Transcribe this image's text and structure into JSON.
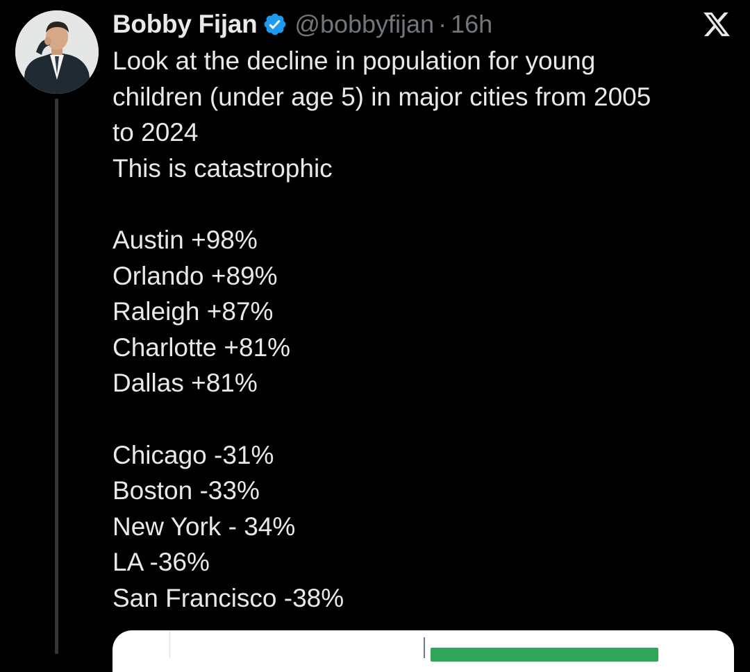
{
  "tweet": {
    "author": {
      "display_name": "Bobby Fijan",
      "handle": "@bobbyfijan",
      "separator": "·",
      "time": "16h",
      "verified": true
    },
    "lines": [
      "Look at the decline in population for young",
      "children (under age 5) in major cities from 2005",
      "to 2024",
      "This is catastrophic"
    ],
    "growth_list": [
      "Austin +98%",
      "Orlando +89%",
      "Raleigh +87%",
      "Charlotte +81%",
      "Dallas +81%"
    ],
    "decline_list": [
      "Chicago -31%",
      "Boston -33%",
      "New York - 34%",
      "LA -36%",
      "San Francisco -38%"
    ]
  },
  "colors": {
    "background": "#000000",
    "text": "#e7e9ea",
    "secondary_text": "#71767b",
    "verified_badge": "#1d9bf0",
    "thread_line": "#333639",
    "media_bar": "#2fa65a"
  },
  "icons": {
    "verified": "verified-badge-icon",
    "brand": "x-logo-icon"
  }
}
